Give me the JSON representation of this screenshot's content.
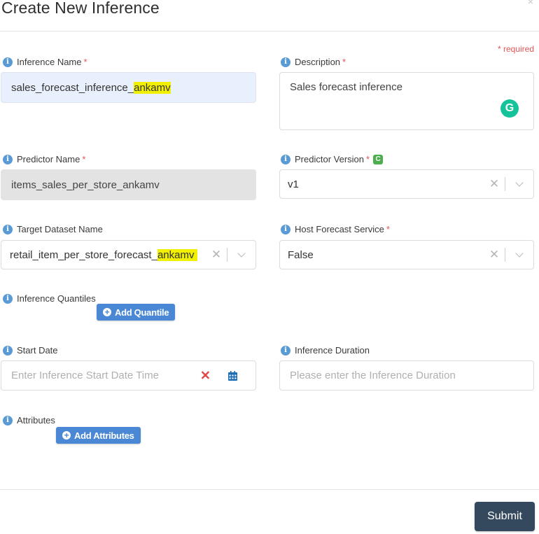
{
  "dialog": {
    "title": "Create New Inference",
    "close_glyph": "×",
    "required_note": "* required"
  },
  "icons": {
    "info": "i",
    "required_star": "*",
    "refresh": "C",
    "grammarly": "G",
    "clear": "✕",
    "plus": "+"
  },
  "fields": {
    "inference_name": {
      "label": "Inference Name",
      "required": true,
      "value_prefix": "sales_forecast_inference_",
      "value_highlight": "ankamv"
    },
    "description": {
      "label": "Description",
      "required": true,
      "value": "Sales forecast inference"
    },
    "predictor_name": {
      "label": "Predictor Name",
      "required": true,
      "value": "items_sales_per_store_ankamv"
    },
    "predictor_version": {
      "label": "Predictor Version",
      "required": true,
      "value": "v1"
    },
    "target_dataset_name": {
      "label": "Target Dataset Name",
      "required": false,
      "value_prefix": "retail_item_per_store_forecast_",
      "value_highlight": "ankamv "
    },
    "host_forecast_service": {
      "label": "Host Forecast Service",
      "required": true,
      "value": "False"
    },
    "inference_quantiles": {
      "label": "Inference Quantiles",
      "button_label": "Add Quantile"
    },
    "start_date": {
      "label": "Start Date",
      "placeholder": "Enter Inference Start Date Time"
    },
    "inference_duration": {
      "label": "Inference Duration",
      "placeholder": "Please enter the Inference Duration"
    },
    "attributes": {
      "label": "Attributes",
      "button_label": "Add Attributes"
    }
  },
  "footer": {
    "submit_label": "Submit"
  },
  "colors": {
    "accent_button": "#4a88d6",
    "submit_button": "#34495e",
    "required": "#e05555",
    "highlight": "#f0f000",
    "grammarly": "#15c39a"
  }
}
